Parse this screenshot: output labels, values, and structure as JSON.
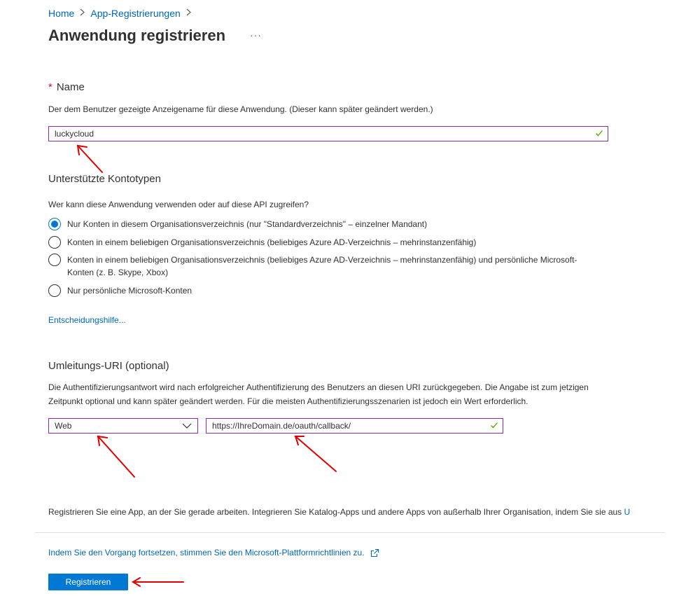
{
  "breadcrumb": {
    "home": "Home",
    "app_registrations": "App-Registrierungen"
  },
  "page": {
    "title": "Anwendung registrieren",
    "more": "···"
  },
  "name_section": {
    "required_marker": "*",
    "label": "Name",
    "description": "Der dem Benutzer gezeigte Anzeigename für diese Anwendung. (Dieser kann später geändert werden.)",
    "value": "luckycloud"
  },
  "account_types": {
    "heading": "Unterstützte Kontotypen",
    "question": "Wer kann diese Anwendung verwenden oder auf diese API zugreifen?",
    "options": [
      {
        "label": "Nur Konten in diesem Organisationsverzeichnis (nur \"Standardverzeichnis\" – einzelner Mandant)",
        "selected": true
      },
      {
        "label": "Konten in einem beliebigen Organisationsverzeichnis (beliebiges Azure AD-Verzeichnis – mehrinstanzenfähig)",
        "selected": false
      },
      {
        "label": "Konten in einem beliebigen Organisationsverzeichnis (beliebiges Azure AD-Verzeichnis – mehrinstanzenfähig) und persönliche Microsoft-Konten (z. B. Skype, Xbox)",
        "selected": false
      },
      {
        "label": "Nur persönliche Microsoft-Konten",
        "selected": false
      }
    ],
    "help_link": "Entscheidungshilfe..."
  },
  "redirect": {
    "heading": "Umleitungs-URI (optional)",
    "description": "Die Authentifizierungsantwort wird nach erfolgreicher Authentifizierung des Benutzers an diesen URI zurückgegeben. Die Angabe ist zum jetzigen Zeitpunkt optional und kann später geändert werden. Für die meisten Authentifizierungsszenarien ist jedoch ein Wert erforderlich.",
    "platform": "Web",
    "uri": "https://IhreDomain.de/oauth/callback/"
  },
  "footer": {
    "info": "Registrieren Sie eine App, an der Sie gerade arbeiten. Integrieren Sie Katalog-Apps und andere Apps von außerhalb Ihrer Organisation, indem Sie sie aus",
    "info_link": "U",
    "policy_link": "Indem Sie den Vorgang fortsetzen, stimmen Sie den Microsoft-Plattformrichtlinien zu.",
    "register_button": "Registrieren"
  },
  "colors": {
    "accent": "#0078d4",
    "link": "#0067b8",
    "input_border": "#8a2da5",
    "valid_check": "#57a300",
    "annotation_arrow": "#e00000"
  }
}
